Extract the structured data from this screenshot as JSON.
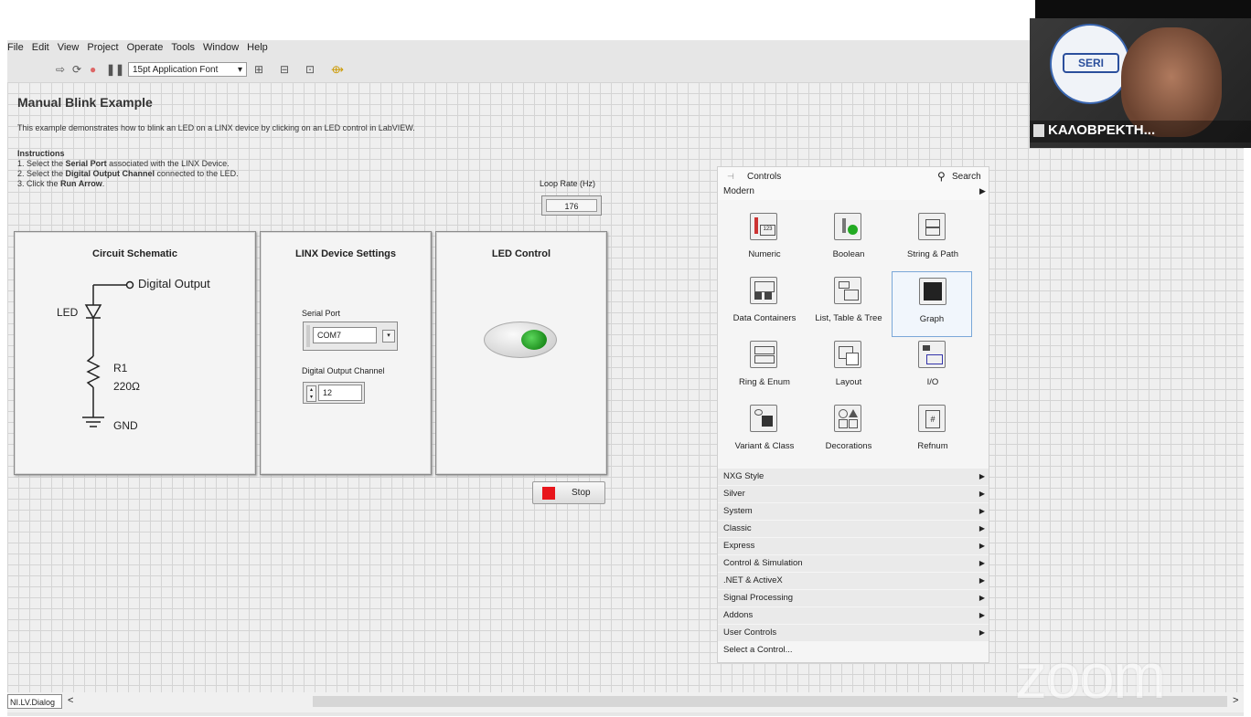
{
  "menu": [
    "File",
    "Edit",
    "View",
    "Project",
    "Operate",
    "Tools",
    "Window",
    "Help"
  ],
  "toolbar": {
    "font": "15pt Application Font"
  },
  "vi": {
    "title": "Manual Blink Example",
    "description": "This example demonstrates how to blink an LED on a LINX device by clicking on an LED control in LabVIEW.",
    "instructions_heading": "Instructions",
    "step1_pre": "1. Select the ",
    "step1_bold": "Serial Port",
    "step1_post": " associated with the LINX Device.",
    "step2_pre": "2. Select the ",
    "step2_bold": "Digital Output Channel",
    "step2_post": " connected to the LED.",
    "step3_pre": "3. Click the ",
    "step3_bold": "Run Arrow",
    "step3_post": ".",
    "loop_rate_label": "Loop Rate (Hz)",
    "loop_rate_value": "176"
  },
  "schematic": {
    "title": "Circuit Schematic",
    "output_label": "Digital Output",
    "led_label": "LED",
    "resistor_name": "R1",
    "resistor_value": "220Ω",
    "gnd_label": "GND"
  },
  "linx": {
    "title": "LINX Device Settings",
    "serial_label": "Serial Port",
    "serial_value": "COM7",
    "channel_label": "Digital Output Channel",
    "channel_value": "12"
  },
  "led": {
    "title": "LED Control",
    "color": "#1e8f1e"
  },
  "stop": {
    "label": "Stop",
    "color": "#e8151b"
  },
  "palette": {
    "title": "Controls",
    "search": "Search",
    "category": "Modern",
    "items": [
      "Numeric",
      "Boolean",
      "String & Path",
      "Data Containers",
      "List, Table & Tree",
      "Graph",
      "Ring & Enum",
      "Layout",
      "I/O",
      "Variant & Class",
      "Decorations",
      "Refnum"
    ],
    "subpalettes": [
      "NXG Style",
      "Silver",
      "System",
      "Classic",
      "Express",
      "Control & Simulation",
      ".NET & ActiveX",
      "Signal Processing",
      "Addons",
      "User Controls"
    ],
    "select_control": "Select a Control..."
  },
  "status": {
    "dialog": "NI.LV.Dialog",
    "scroll_left": "<",
    "scroll_right": ">"
  },
  "webcam": {
    "name": "ΚΑΛΟΒΡΕΚΤΗ...",
    "logo_text": "SERI"
  },
  "zoom_watermark": "zoom"
}
